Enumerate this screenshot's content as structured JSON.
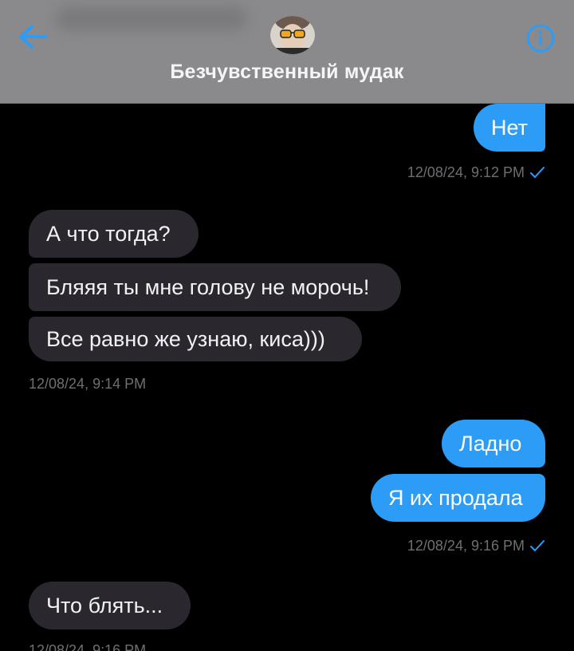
{
  "header": {
    "contact_name": "Безчувственный мудак",
    "back_icon": "arrow-left-icon",
    "info_icon": "info-circle-icon",
    "accent_color": "#2c9cf6"
  },
  "messages": [
    {
      "direction": "outgoing",
      "text": "Нет"
    },
    {
      "timestamp": "12/08/24, 9:12 PM",
      "read": true
    },
    {
      "direction": "incoming",
      "text": "А что тогда?"
    },
    {
      "direction": "incoming",
      "text": "Бляяя ты мне голову не морочь!"
    },
    {
      "direction": "incoming",
      "text": "Все равно же узнаю, киса)))"
    },
    {
      "timestamp": "12/08/24, 9:14 PM"
    },
    {
      "direction": "outgoing",
      "text": "Ладно"
    },
    {
      "direction": "outgoing",
      "text": "Я их продала"
    },
    {
      "timestamp": "12/08/24, 9:16 PM",
      "read": true
    },
    {
      "direction": "incoming",
      "text": "Что блять..."
    },
    {
      "timestamp": "12/08/24, 9:16 PM"
    }
  ]
}
